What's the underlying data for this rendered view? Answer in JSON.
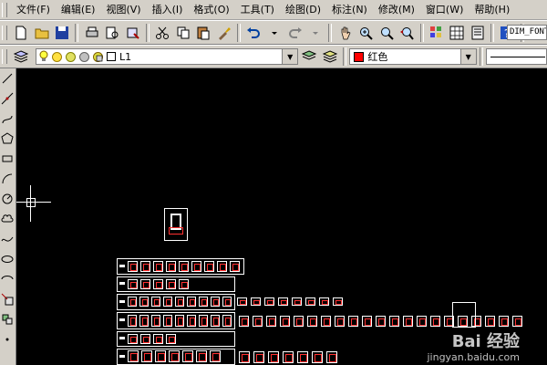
{
  "menu": {
    "items": [
      "文件(F)",
      "编辑(E)",
      "视图(V)",
      "插入(I)",
      "格式(O)",
      "工具(T)",
      "绘图(D)",
      "标注(N)",
      "修改(M)",
      "窗口(W)",
      "帮助(H)"
    ]
  },
  "toolbar": {
    "font_field": "DIM_FONT"
  },
  "layer_bar": {
    "layer_name": "L1",
    "color_label": "红色",
    "color_swatch": "#ff0000"
  },
  "watermark": {
    "brand": "Bai 经验",
    "url": "jingyan.baidu.com"
  }
}
